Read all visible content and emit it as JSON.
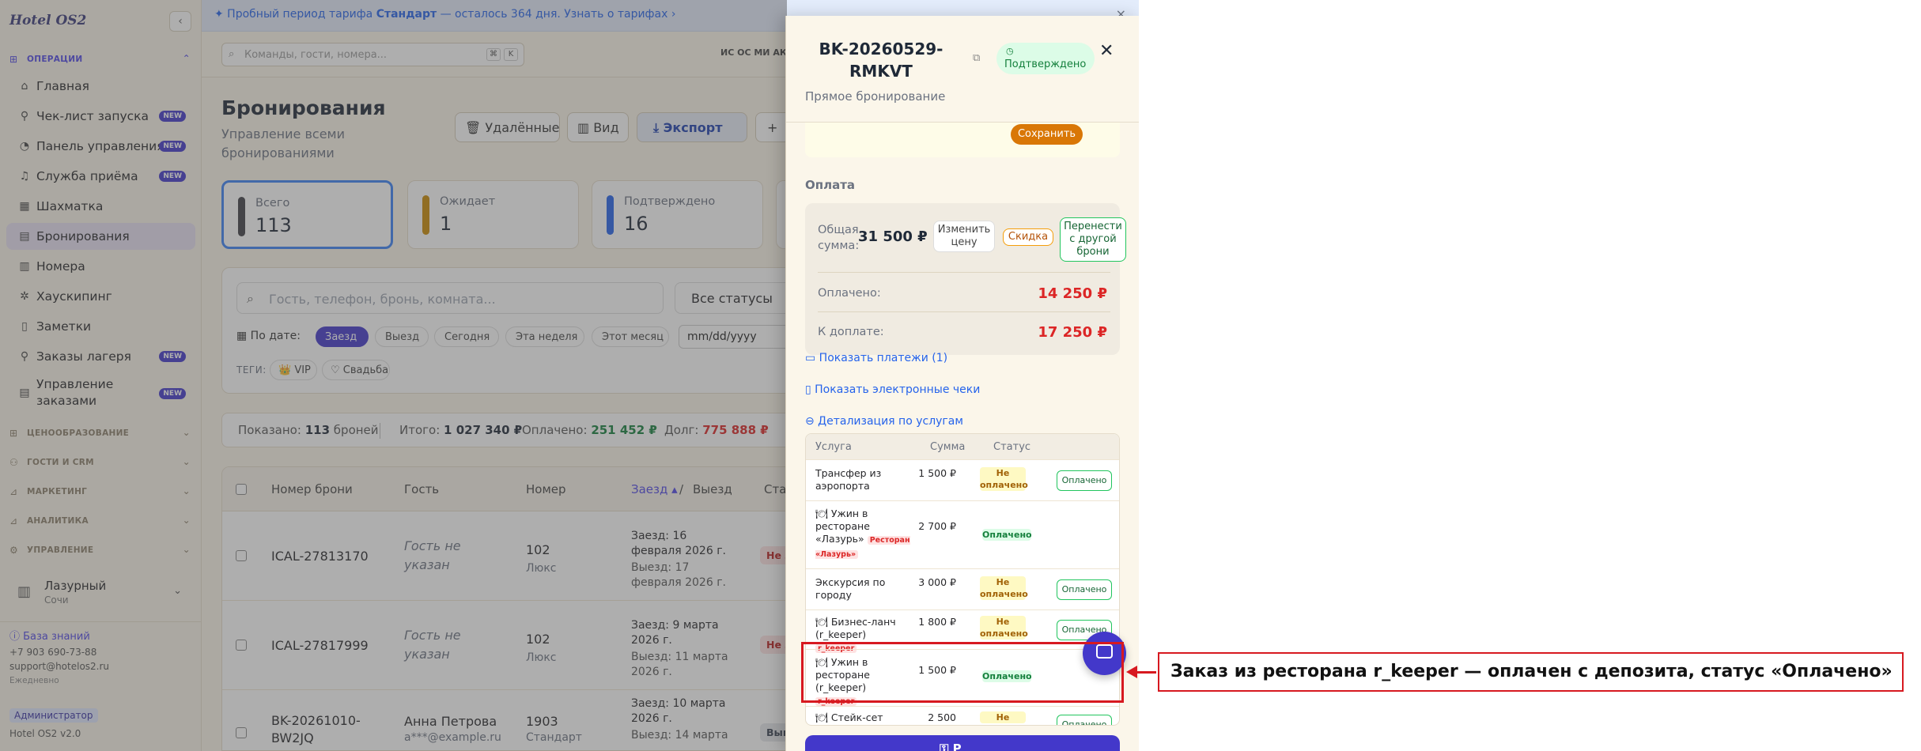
{
  "app": {
    "logo": "Hotel OS2",
    "collapse": "‹"
  },
  "sidebar": {
    "sections": [
      {
        "label": "Операции",
        "icon": "⊞",
        "open": true
      },
      {
        "label": "Ценообразование",
        "icon": "⊞"
      },
      {
        "label": "Гости и CRM",
        "icon": "⚇"
      },
      {
        "label": "Маркетинг",
        "icon": "⊿"
      },
      {
        "label": "Аналитика",
        "icon": "⊿"
      },
      {
        "label": "Управление",
        "icon": "⚙"
      }
    ],
    "items": [
      {
        "label": "Главная",
        "icon": "⌂"
      },
      {
        "label": "Чек-лист запуска",
        "icon": "⚲",
        "badge": "NEW"
      },
      {
        "label": "Панель управления",
        "icon": "◔",
        "badge": "NEW"
      },
      {
        "label": "Служба приёма",
        "icon": "♫",
        "badge": "NEW"
      },
      {
        "label": "Шахматка",
        "icon": "▦"
      },
      {
        "label": "Бронирования",
        "icon": "▤"
      },
      {
        "label": "Номера",
        "icon": "▥"
      },
      {
        "label": "Хаускипинг",
        "icon": "✲"
      },
      {
        "label": "Заметки",
        "icon": "▯"
      },
      {
        "label": "Заказы лагеря",
        "icon": "⚲",
        "badge": "NEW"
      },
      {
        "label": "Управление заказами",
        "icon": "▤",
        "badge": "NEW"
      }
    ],
    "hotel": {
      "name": "Лазурный",
      "city": "Сочи"
    },
    "footer": {
      "knowledge_base": "ⓘ База знаний",
      "phone": "+7 903 690-73-88",
      "email": "support@hotelos2.ru",
      "hours": "Ежедневно",
      "role": "Администратор",
      "version": "Hotel OS2 v2.0"
    }
  },
  "trial": {
    "prefix": "✦ Пробный период тарифа ",
    "plan": "Стандарт",
    "rest": " — осталось 364 дня. Узнать о тарифах ›",
    "close": "×"
  },
  "topbar": {
    "search_placeholder": "Команды, гости, номера...",
    "keys": [
      "⌘",
      "K"
    ],
    "avatars": "ИС ОС МИ АК"
  },
  "page": {
    "title": "Бронирования",
    "subtitle": "Управление всеми бронированиями",
    "buttons": {
      "deleted": "🗑 Удалённые",
      "view": "▥ Вид",
      "export": "⤓ Экспорт"
    }
  },
  "stats": [
    {
      "label": "Всего",
      "value": "113",
      "color": "#3f3f46"
    },
    {
      "label": "Ожидает",
      "value": "1",
      "color": "#ca8a04"
    },
    {
      "label": "Подтверждено",
      "value": "16",
      "color": "#2563eb"
    }
  ],
  "filters": {
    "search_placeholder": "Гость, телефон, бронь, комната...",
    "status": "Все статусы",
    "by_date": "▦ По дате:",
    "pills": [
      "Заезд",
      "Выезд",
      "Сегодня",
      "Эта неделя",
      "Этот месяц"
    ],
    "date_placeholder": "mm/dd/yyyy",
    "tags_label": "ТЕГИ:",
    "tags": [
      "👑 VIP",
      "♡ Свадьба"
    ]
  },
  "summary": {
    "shown_prefix": "Показано:",
    "shown_count": "113",
    "shown_suffix": "броней",
    "total_label": "Итого:",
    "total_value": "1 027 340 ₽",
    "paid_label": "Оплачено:",
    "paid_value": "251 452 ₽",
    "debt_label": "Долг:",
    "debt_value": "775 888 ₽"
  },
  "table": {
    "headers": {
      "id": "Номер брони",
      "guest": "Гость",
      "room": "Номер",
      "checkin": "Заезд ▴",
      "slash": "/",
      "checkout": "Выезд",
      "status": "Статус"
    },
    "rows": [
      {
        "id": "ICAL-27813170",
        "guest": "Гость не указан",
        "room": "102",
        "room_type": "Люкс",
        "in": "Заезд: 16 февраля 2026 г.",
        "out": "Выезд: 17 февраля 2026 г.",
        "status": "Не заезд"
      },
      {
        "id": "ICAL-27817999",
        "guest": "Гость не указан",
        "room": "102",
        "room_type": "Люкс",
        "in": "Заезд: 9 марта 2026 г.",
        "out": "Выезд: 11 марта 2026 г.",
        "status": "Не заезд"
      },
      {
        "id": "BK-20261010-BW2JQ",
        "guest": "Анна Петрова",
        "guest_email": "a***@example.ru",
        "room": "1903",
        "room_type": "Стандарт",
        "in": "Заезд: 10 марта 2026 г.",
        "out": "Выезд: 14 марта",
        "status": "Выписан"
      }
    ]
  },
  "panel": {
    "booking_id": "BK-20260529-RMKVT",
    "copy_icon": "⧉",
    "status_icon": "◷",
    "status": "Подтверждено",
    "close": "✕",
    "source": "Прямое бронирование",
    "save": "Сохранить",
    "payment_title": "Оплата",
    "total_label": "Общая сумма:",
    "total_value": "31 500 ₽",
    "change_price": "Изменить цену",
    "discount": "Скидка",
    "transfer": "Перенести с другой брони",
    "paid_label": "Оплачено:",
    "paid_value": "14 250 ₽",
    "due_label": "К доплате:",
    "due_value": "17 250 ₽",
    "show_payments": "▭ Показать платежи (1)",
    "show_receipts": "▯ Показать электронные чеки",
    "services_toggle": "⊖ Детализация по услугам",
    "services_headers": {
      "service": "Услуга",
      "amount": "Сумма",
      "status": "Статус"
    },
    "services": [
      {
        "name": "Трансфер из аэропорта",
        "amount": "1 500 ₽",
        "status": "Не оплачено",
        "paid": false,
        "action": "Оплачено"
      },
      {
        "name": "🍽 Ужин в ресторане «Лазурь»",
        "tag": "Ресторан «Лазурь»",
        "amount": "2 700 ₽",
        "status": "Оплачено",
        "paid": true
      },
      {
        "name": "Экскурсия по городу",
        "amount": "3 000 ₽",
        "status": "Не оплачено",
        "paid": false,
        "action": "Оплачено"
      },
      {
        "name": "🍽 Бизнес-ланч (r_keeper)",
        "tag": "r_keeper",
        "amount": "1 800 ₽",
        "status": "Не оплачено",
        "paid": false,
        "action": "Оплачено"
      },
      {
        "name": "🍽 Ужин в ресторане (r_keeper)",
        "tag": "r_keeper",
        "amount": "1 500 ₽",
        "status": "Оплачено",
        "paid": true
      },
      {
        "name": "🍽 Стейк-сет",
        "amount": "2 500",
        "status": "Не",
        "paid": false,
        "action": "Оплачено"
      }
    ],
    "bottom_button": "⚿ Р"
  },
  "annotation": {
    "text": "Заказ из ресторана r_keeper — оплачен с депозита, статус «Оплачено»",
    "color": "#d71920"
  }
}
